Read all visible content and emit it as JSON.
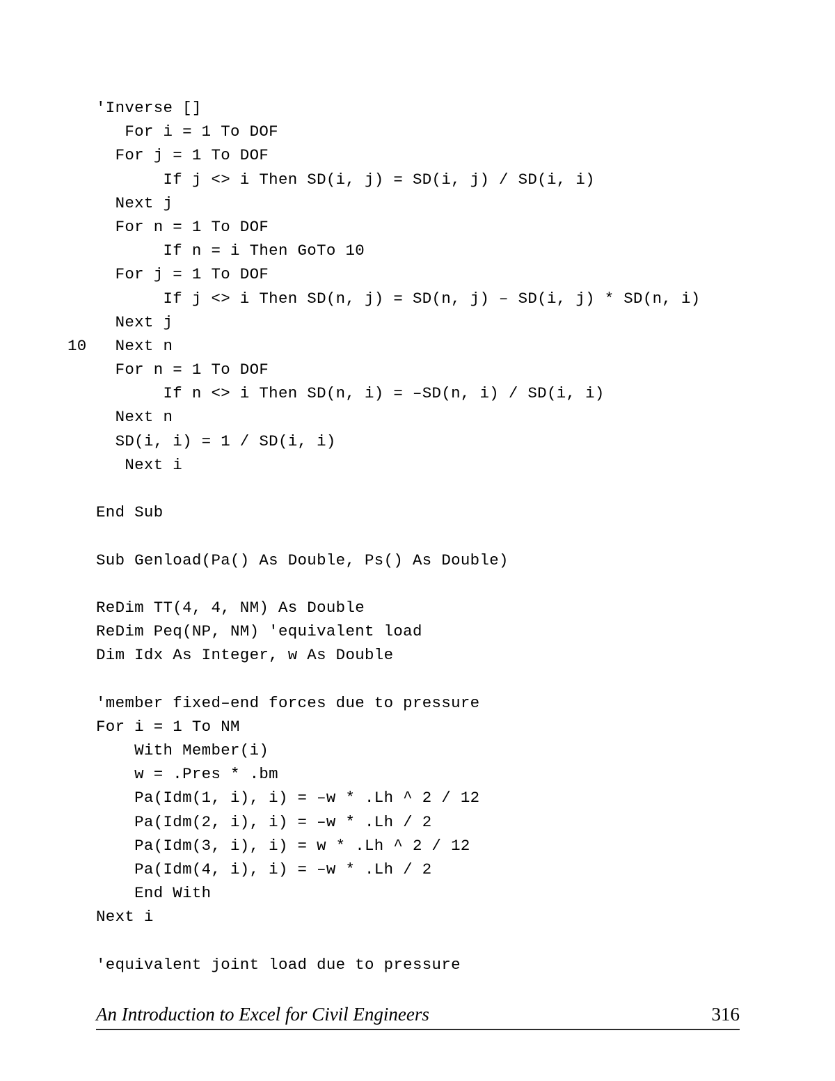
{
  "document": {
    "kind": "book-page",
    "background_color": "#ffffff",
    "text_color": "#000000"
  },
  "code": {
    "language": "VBA",
    "lines": [
      {
        "label": "",
        "text": "'Inverse []"
      },
      {
        "label": "",
        "text": "   For i = 1 To DOF"
      },
      {
        "label": "",
        "text": "  For j = 1 To DOF"
      },
      {
        "label": "",
        "text": "       If j <> i Then SD(i, j) = SD(i, j) / SD(i, i)"
      },
      {
        "label": "",
        "text": "  Next j"
      },
      {
        "label": "",
        "text": "  For n = 1 To DOF"
      },
      {
        "label": "",
        "text": "       If n = i Then GoTo 10"
      },
      {
        "label": "",
        "text": "  For j = 1 To DOF"
      },
      {
        "label": "",
        "text": "       If j <> i Then SD(n, j) = SD(n, j) – SD(i, j) * SD(n, i)"
      },
      {
        "label": "",
        "text": "  Next j"
      },
      {
        "label": "10",
        "text": "  Next n"
      },
      {
        "label": "",
        "text": "  For n = 1 To DOF"
      },
      {
        "label": "",
        "text": "       If n <> i Then SD(n, i) = –SD(n, i) / SD(i, i)"
      },
      {
        "label": "",
        "text": "  Next n"
      },
      {
        "label": "",
        "text": "  SD(i, i) = 1 / SD(i, i)"
      },
      {
        "label": "",
        "text": "   Next i"
      },
      {
        "label": "",
        "text": ""
      },
      {
        "label": "",
        "text": "End Sub"
      },
      {
        "label": "",
        "text": ""
      },
      {
        "label": "",
        "text": "Sub Genload(Pa() As Double, Ps() As Double)"
      },
      {
        "label": "",
        "text": ""
      },
      {
        "label": "",
        "text": "ReDim TT(4, 4, NM) As Double"
      },
      {
        "label": "",
        "text": "ReDim Peq(NP, NM) 'equivalent load"
      },
      {
        "label": "",
        "text": "Dim Idx As Integer, w As Double"
      },
      {
        "label": "",
        "text": ""
      },
      {
        "label": "",
        "text": "'member fixed–end forces due to pressure"
      },
      {
        "label": "",
        "text": "For i = 1 To NM"
      },
      {
        "label": "",
        "text": "    With Member(i)"
      },
      {
        "label": "",
        "text": "    w = .Pres * .bm"
      },
      {
        "label": "",
        "text": "    Pa(Idm(1, i), i) = –w * .Lh ^ 2 / 12"
      },
      {
        "label": "",
        "text": "    Pa(Idm(2, i), i) = –w * .Lh / 2"
      },
      {
        "label": "",
        "text": "    Pa(Idm(3, i), i) = w * .Lh ^ 2 / 12"
      },
      {
        "label": "",
        "text": "    Pa(Idm(4, i), i) = –w * .Lh / 2"
      },
      {
        "label": "",
        "text": "    End With"
      },
      {
        "label": "",
        "text": "Next i"
      },
      {
        "label": "",
        "text": ""
      },
      {
        "label": "",
        "text": "'equivalent joint load due to pressure"
      }
    ]
  },
  "footer": {
    "title": "An Introduction to Excel for Civil Engineers",
    "page_number": "316",
    "rule_color": "#2b2b2b"
  }
}
